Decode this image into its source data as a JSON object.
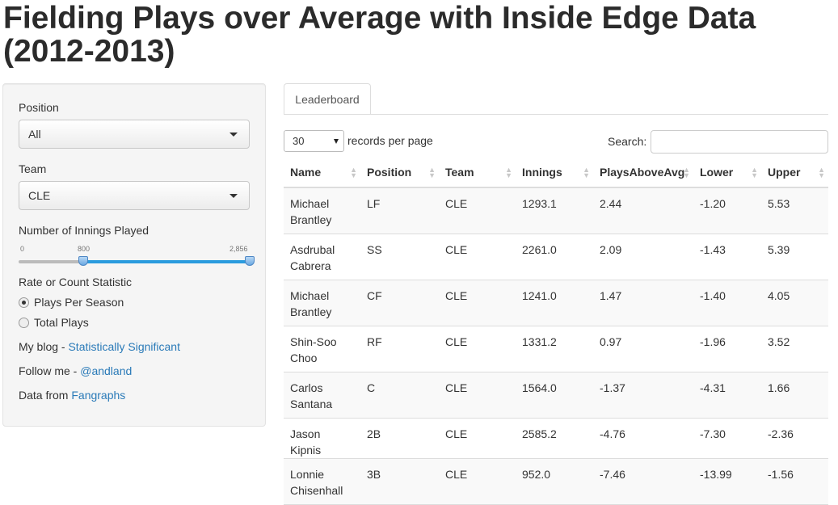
{
  "page": {
    "title": "Fielding Plays over Average with Inside Edge Data (2012-2013)"
  },
  "sidebar": {
    "position_label": "Position",
    "position_value": "All",
    "team_label": "Team",
    "team_value": "CLE",
    "innings_label": "Number of Innings Played",
    "slider_min_label": "0",
    "slider_low_label": "800",
    "slider_max_label": "2,856",
    "slider_range": {
      "min": 0,
      "max": 2856,
      "low": 800,
      "high": 2856
    },
    "stat_label": "Rate or Count Statistic",
    "stat_options": [
      "Plays Per Season",
      "Total Plays"
    ],
    "stat_selected": "Plays Per Season",
    "blog_prefix": "My blog - ",
    "blog_link": "Statistically Significant",
    "follow_prefix": "Follow me - ",
    "follow_link": "@andland",
    "data_prefix": "Data from ",
    "data_link": "Fangraphs"
  },
  "main": {
    "tab_label": "Leaderboard",
    "records_value": "30",
    "records_label": "records per page",
    "search_label": "Search:",
    "search_value": "",
    "columns": [
      "Name",
      "Position",
      "Team",
      "Innings",
      "PlaysAboveAvg",
      "Lower",
      "Upper"
    ],
    "rows": [
      [
        "Michael Brantley",
        "LF",
        "CLE",
        "1293.1",
        "2.44",
        "-1.20",
        "5.53"
      ],
      [
        "Asdrubal Cabrera",
        "SS",
        "CLE",
        "2261.0",
        "2.09",
        "-1.43",
        "5.39"
      ],
      [
        "Michael Brantley",
        "CF",
        "CLE",
        "1241.0",
        "1.47",
        "-1.40",
        "4.05"
      ],
      [
        "Shin-Soo Choo",
        "RF",
        "CLE",
        "1331.2",
        "0.97",
        "-1.96",
        "3.52"
      ],
      [
        "Carlos Santana",
        "C",
        "CLE",
        "1564.0",
        "-1.37",
        "-4.31",
        "1.66"
      ],
      [
        "Jason Kipnis",
        "2B",
        "CLE",
        "2585.2",
        "-4.76",
        "-7.30",
        "-2.36"
      ],
      [
        "Lonnie Chisenhall",
        "3B",
        "CLE",
        "952.0",
        "-7.46",
        "-13.99",
        "-1.56"
      ]
    ]
  },
  "colors": {
    "link": "#2a7ab8",
    "slider_fill": "#2a9bde",
    "panel_bg": "#f5f5f5"
  }
}
